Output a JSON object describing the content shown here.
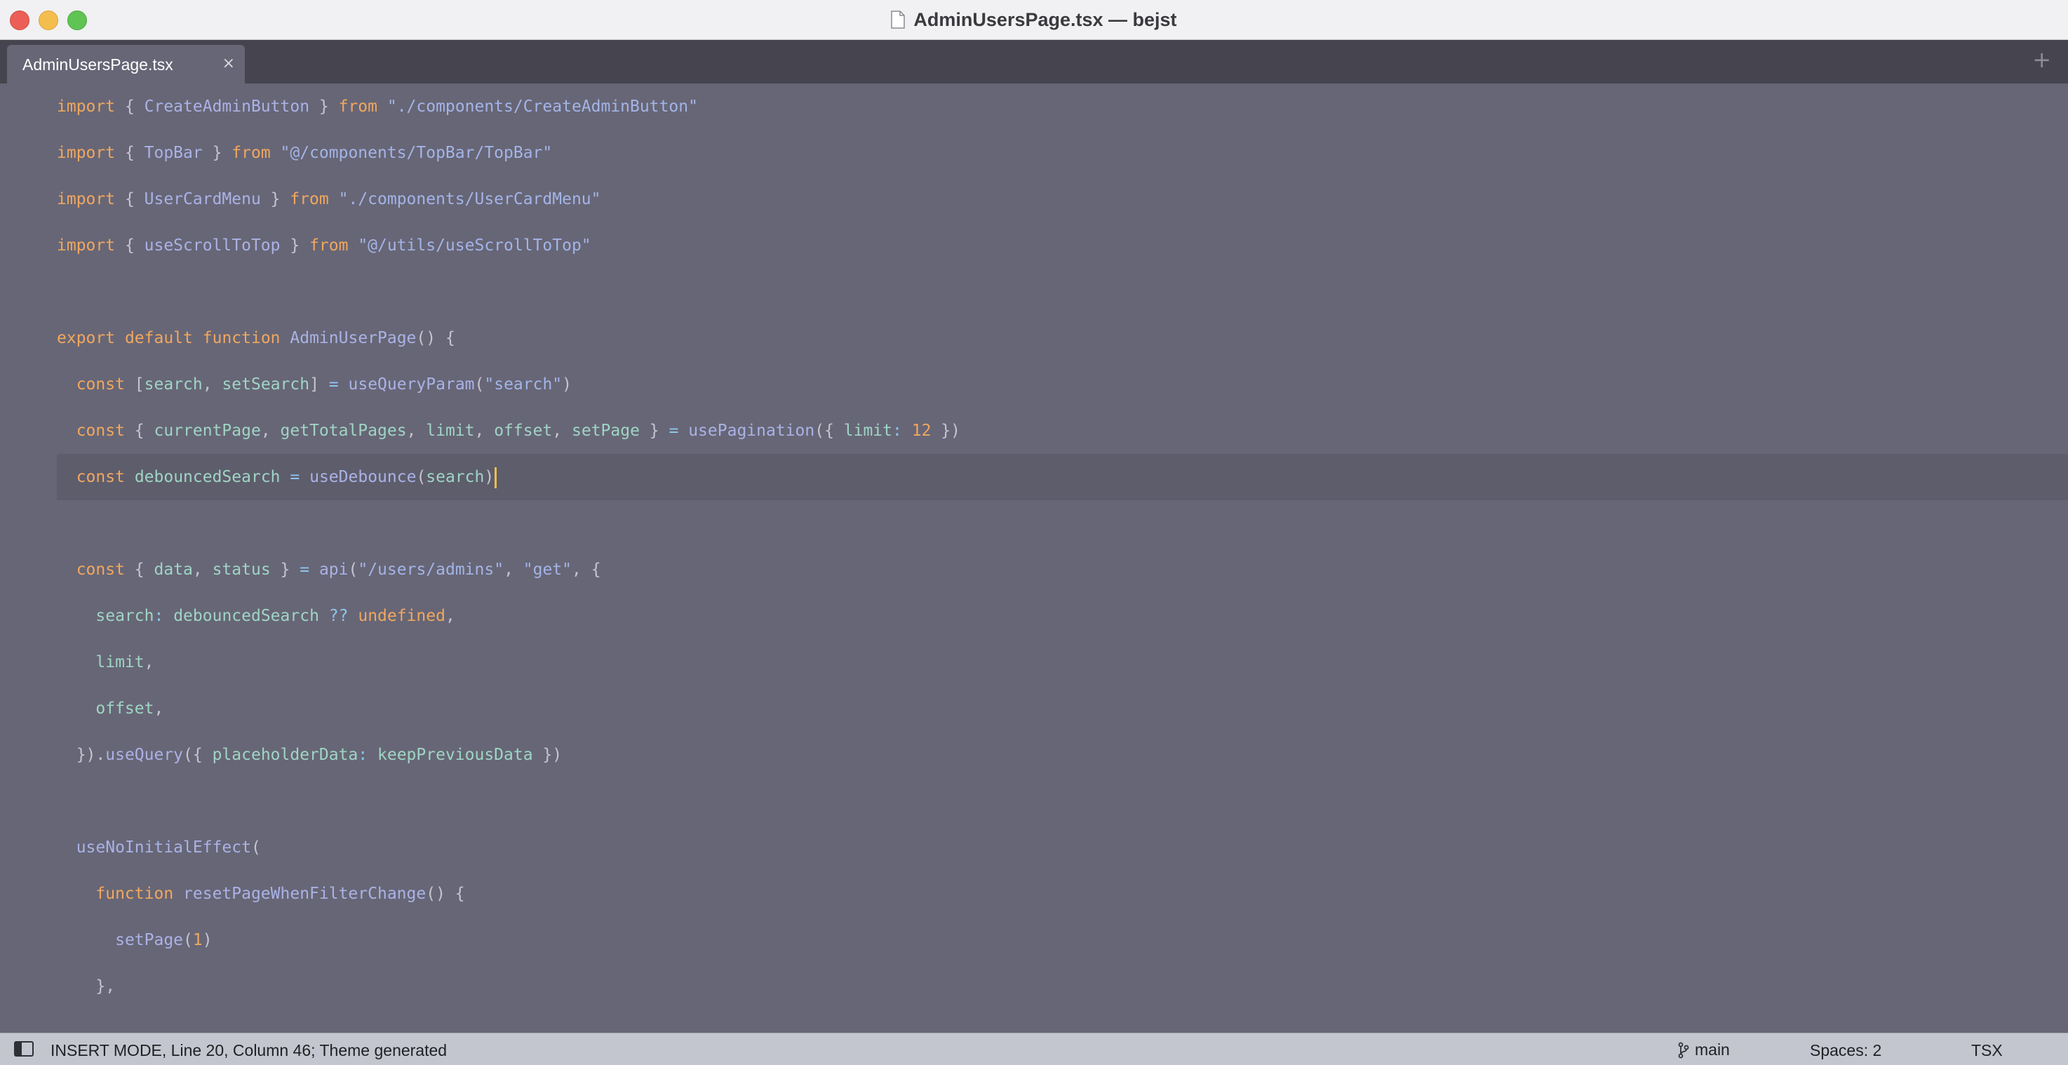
{
  "window": {
    "title": "AdminUsersPage.tsx — bejst"
  },
  "tabs": {
    "active_label": "AdminUsersPage.tsx",
    "close_glyph": "×",
    "add_glyph": "+"
  },
  "editor": {
    "current_line": 8,
    "lines": [
      [
        [
          "kw",
          "import"
        ],
        [
          "br",
          " { "
        ],
        [
          "fn",
          "CreateAdminButton"
        ],
        [
          "br",
          " } "
        ],
        [
          "kw",
          "from"
        ],
        [
          "br",
          " "
        ],
        [
          "str",
          "\"./components/CreateAdminButton\""
        ]
      ],
      [
        [
          "kw",
          "import"
        ],
        [
          "br",
          " { "
        ],
        [
          "fn",
          "TopBar"
        ],
        [
          "br",
          " } "
        ],
        [
          "kw",
          "from"
        ],
        [
          "br",
          " "
        ],
        [
          "str",
          "\"@/components/TopBar/TopBar\""
        ]
      ],
      [
        [
          "kw",
          "import"
        ],
        [
          "br",
          " { "
        ],
        [
          "fn",
          "UserCardMenu"
        ],
        [
          "br",
          " } "
        ],
        [
          "kw",
          "from"
        ],
        [
          "br",
          " "
        ],
        [
          "str",
          "\"./components/UserCardMenu\""
        ]
      ],
      [
        [
          "kw",
          "import"
        ],
        [
          "br",
          " { "
        ],
        [
          "fn",
          "useScrollToTop"
        ],
        [
          "br",
          " } "
        ],
        [
          "kw",
          "from"
        ],
        [
          "br",
          " "
        ],
        [
          "str",
          "\"@/utils/useScrollToTop\""
        ]
      ],
      [],
      [
        [
          "kw",
          "export"
        ],
        [
          "br",
          " "
        ],
        [
          "kw",
          "default"
        ],
        [
          "br",
          " "
        ],
        [
          "kw",
          "function"
        ],
        [
          "br",
          " "
        ],
        [
          "fn",
          "AdminUserPage"
        ],
        [
          "br",
          "() {"
        ]
      ],
      [
        [
          "br",
          "  "
        ],
        [
          "kw",
          "const"
        ],
        [
          "br",
          " ["
        ],
        [
          "id",
          "search"
        ],
        [
          "br",
          ", "
        ],
        [
          "id",
          "setSearch"
        ],
        [
          "br",
          "] "
        ],
        [
          "op",
          "="
        ],
        [
          "br",
          " "
        ],
        [
          "fn",
          "useQueryParam"
        ],
        [
          "br",
          "("
        ],
        [
          "str",
          "\"search\""
        ],
        [
          "br",
          ")"
        ]
      ],
      [
        [
          "br",
          "  "
        ],
        [
          "kw",
          "const"
        ],
        [
          "br",
          " { "
        ],
        [
          "id",
          "currentPage"
        ],
        [
          "br",
          ", "
        ],
        [
          "id",
          "getTotalPages"
        ],
        [
          "br",
          ", "
        ],
        [
          "id",
          "limit"
        ],
        [
          "br",
          ", "
        ],
        [
          "id",
          "offset"
        ],
        [
          "br",
          ", "
        ],
        [
          "id",
          "setPage"
        ],
        [
          "br",
          " } "
        ],
        [
          "op",
          "="
        ],
        [
          "br",
          " "
        ],
        [
          "fn",
          "usePagination"
        ],
        [
          "br",
          "({ "
        ],
        [
          "prop",
          "limit"
        ],
        [
          "op",
          ":"
        ],
        [
          "br",
          " "
        ],
        [
          "num",
          "12"
        ],
        [
          "br",
          " })"
        ]
      ],
      [
        [
          "br",
          "  "
        ],
        [
          "kw",
          "const"
        ],
        [
          "br",
          " "
        ],
        [
          "id",
          "debouncedSearch"
        ],
        [
          "br",
          " "
        ],
        [
          "op",
          "="
        ],
        [
          "br",
          " "
        ],
        [
          "fn",
          "useDebounce"
        ],
        [
          "br",
          "("
        ],
        [
          "id",
          "search"
        ],
        [
          "br",
          ")"
        ]
      ],
      [],
      [
        [
          "br",
          "  "
        ],
        [
          "kw",
          "const"
        ],
        [
          "br",
          " { "
        ],
        [
          "id",
          "data"
        ],
        [
          "br",
          ", "
        ],
        [
          "id",
          "status"
        ],
        [
          "br",
          " } "
        ],
        [
          "op",
          "="
        ],
        [
          "br",
          " "
        ],
        [
          "fn",
          "api"
        ],
        [
          "br",
          "("
        ],
        [
          "str",
          "\"/users/admins\""
        ],
        [
          "br",
          ", "
        ],
        [
          "str",
          "\"get\""
        ],
        [
          "br",
          ", {"
        ]
      ],
      [
        [
          "br",
          "    "
        ],
        [
          "prop",
          "search"
        ],
        [
          "op",
          ":"
        ],
        [
          "br",
          " "
        ],
        [
          "id",
          "debouncedSearch"
        ],
        [
          "br",
          " "
        ],
        [
          "op",
          "??"
        ],
        [
          "br",
          " "
        ],
        [
          "undef",
          "undefined"
        ],
        [
          "br",
          ","
        ]
      ],
      [
        [
          "br",
          "    "
        ],
        [
          "id",
          "limit"
        ],
        [
          "br",
          ","
        ]
      ],
      [
        [
          "br",
          "    "
        ],
        [
          "id",
          "offset"
        ],
        [
          "br",
          ","
        ]
      ],
      [
        [
          "br",
          "  })."
        ],
        [
          "fn",
          "useQuery"
        ],
        [
          "br",
          "({ "
        ],
        [
          "prop",
          "placeholderData"
        ],
        [
          "op",
          ":"
        ],
        [
          "br",
          " "
        ],
        [
          "id",
          "keepPreviousData"
        ],
        [
          "br",
          " })"
        ]
      ],
      [],
      [
        [
          "br",
          "  "
        ],
        [
          "fn",
          "useNoInitialEffect"
        ],
        [
          "br",
          "("
        ]
      ],
      [
        [
          "br",
          "    "
        ],
        [
          "kw",
          "function"
        ],
        [
          "br",
          " "
        ],
        [
          "fn",
          "resetPageWhenFilterChange"
        ],
        [
          "br",
          "() {"
        ]
      ],
      [
        [
          "br",
          "      "
        ],
        [
          "fn",
          "setPage"
        ],
        [
          "br",
          "("
        ],
        [
          "num",
          "1"
        ],
        [
          "br",
          ")"
        ]
      ],
      [
        [
          "br",
          "    },"
        ]
      ]
    ]
  },
  "statusbar": {
    "status_text": "INSERT MODE, Line 20, Column 46; Theme generated",
    "branch": "main",
    "spaces": "Spaces: 2",
    "syntax": "TSX"
  }
}
